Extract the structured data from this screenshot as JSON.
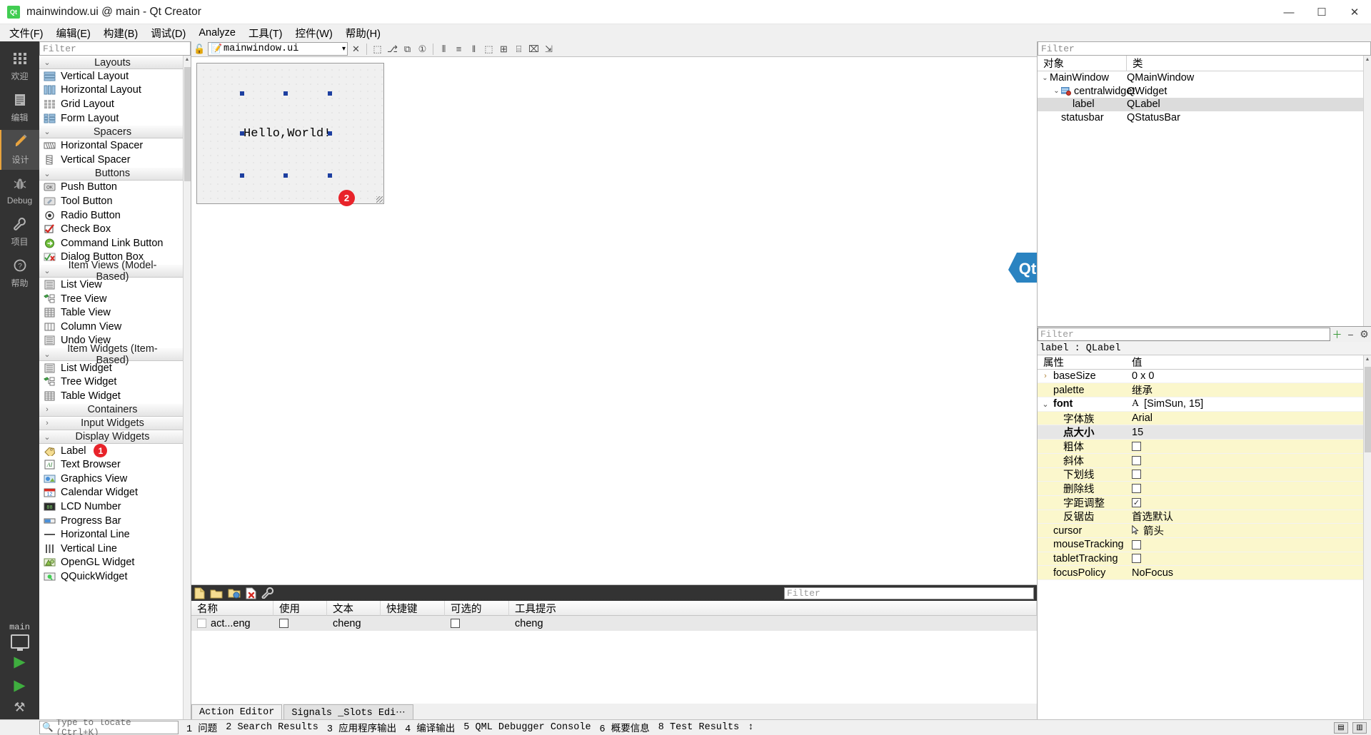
{
  "window": {
    "title": "mainwindow.ui @ main - Qt Creator",
    "logo_text": "Qt",
    "minimize": "—",
    "maximize": "☐",
    "close": "✕"
  },
  "menubar": [
    {
      "label": "文件(F)"
    },
    {
      "label": "编辑(E)"
    },
    {
      "label": "构建(B)"
    },
    {
      "label": "调试(D)"
    },
    {
      "label": "Analyze"
    },
    {
      "label": "工具(T)"
    },
    {
      "label": "控件(W)"
    },
    {
      "label": "帮助(H)"
    }
  ],
  "modebar": {
    "modes": [
      {
        "label": "欢迎",
        "icon": "grid-icon",
        "glyph": "∷",
        "active": false
      },
      {
        "label": "编辑",
        "icon": "document-icon",
        "glyph": "☰",
        "active": false
      },
      {
        "label": "设计",
        "icon": "pencil-icon",
        "glyph": "✎",
        "active": true
      },
      {
        "label": "Debug",
        "icon": "bug-icon",
        "glyph": "☣",
        "active": false
      },
      {
        "label": "项目",
        "icon": "wrench-icon",
        "glyph": "⚒",
        "active": false
      },
      {
        "label": "帮助",
        "icon": "help-icon",
        "glyph": "?",
        "active": false
      }
    ],
    "kit_name": "main",
    "run_glyph": "▶",
    "debug_glyph": "▶",
    "build_glyph": "⚒"
  },
  "widgetbox": {
    "filter_placeholder": "Filter",
    "groups": [
      {
        "title": "Layouts",
        "expanded": true,
        "arrow": "⌄",
        "items": [
          {
            "label": "Vertical Layout",
            "icon": "vertical-layout-icon"
          },
          {
            "label": "Horizontal Layout",
            "icon": "horizontal-layout-icon"
          },
          {
            "label": "Grid Layout",
            "icon": "grid-layout-icon"
          },
          {
            "label": "Form Layout",
            "icon": "form-layout-icon"
          }
        ]
      },
      {
        "title": "Spacers",
        "expanded": true,
        "arrow": "⌄",
        "items": [
          {
            "label": "Horizontal Spacer",
            "icon": "horizontal-spacer-icon"
          },
          {
            "label": "Vertical Spacer",
            "icon": "vertical-spacer-icon"
          }
        ]
      },
      {
        "title": "Buttons",
        "expanded": true,
        "arrow": "⌄",
        "items": [
          {
            "label": "Push Button",
            "icon": "push-button-icon"
          },
          {
            "label": "Tool Button",
            "icon": "tool-button-icon"
          },
          {
            "label": "Radio Button",
            "icon": "radio-button-icon"
          },
          {
            "label": "Check Box",
            "icon": "check-box-icon"
          },
          {
            "label": "Command Link Button",
            "icon": "command-link-button-icon"
          },
          {
            "label": "Dialog Button Box",
            "icon": "dialog-button-box-icon"
          }
        ]
      },
      {
        "title": "Item Views (Model-Based)",
        "expanded": true,
        "arrow": "⌄",
        "items": [
          {
            "label": "List View",
            "icon": "list-view-icon"
          },
          {
            "label": "Tree View",
            "icon": "tree-view-icon"
          },
          {
            "label": "Table View",
            "icon": "table-view-icon"
          },
          {
            "label": "Column View",
            "icon": "column-view-icon"
          },
          {
            "label": "Undo View",
            "icon": "undo-view-icon"
          }
        ]
      },
      {
        "title": "Item Widgets (Item-Based)",
        "expanded": true,
        "arrow": "⌄",
        "items": [
          {
            "label": "List Widget",
            "icon": "list-widget-icon"
          },
          {
            "label": "Tree Widget",
            "icon": "tree-widget-icon"
          },
          {
            "label": "Table Widget",
            "icon": "table-widget-icon"
          }
        ]
      },
      {
        "title": "Containers",
        "expanded": false,
        "arrow": "›",
        "items": []
      },
      {
        "title": "Input Widgets",
        "expanded": false,
        "arrow": "›",
        "items": []
      },
      {
        "title": "Display Widgets",
        "expanded": true,
        "arrow": "⌄",
        "items": [
          {
            "label": "Label",
            "icon": "label-icon",
            "badge": "1"
          },
          {
            "label": "Text Browser",
            "icon": "text-browser-icon"
          },
          {
            "label": "Graphics View",
            "icon": "graphics-view-icon"
          },
          {
            "label": "Calendar Widget",
            "icon": "calendar-widget-icon"
          },
          {
            "label": "LCD Number",
            "icon": "lcd-number-icon"
          },
          {
            "label": "Progress Bar",
            "icon": "progress-bar-icon"
          },
          {
            "label": "Horizontal Line",
            "icon": "horizontal-line-icon"
          },
          {
            "label": "Vertical Line",
            "icon": "vertical-line-icon"
          },
          {
            "label": "OpenGL Widget",
            "icon": "opengl-widget-icon"
          },
          {
            "label": "QQuickWidget",
            "icon": "qquickwidget-icon"
          }
        ]
      }
    ]
  },
  "editor_toolbar": {
    "file_name": "mainwindow.ui",
    "file_icon": "ui-file-icon",
    "lock_icon": "lock-icon",
    "dropdown_arrow": "▾",
    "close_label": "✕",
    "tools": [
      {
        "icon": "edit-widgets-icon",
        "glyph": "⬚"
      },
      {
        "icon": "edit-signals-slots-icon",
        "glyph": "⎇"
      },
      {
        "icon": "edit-buddies-icon",
        "glyph": "⧉"
      },
      {
        "icon": "edit-tab-order-icon",
        "glyph": "①"
      },
      {
        "icon": "layout-horizontally-icon",
        "glyph": "⦀"
      },
      {
        "icon": "layout-vertically-icon",
        "glyph": "≡"
      },
      {
        "icon": "layout-splitter-h-icon",
        "glyph": "‖"
      },
      {
        "icon": "layout-splitter-v-icon",
        "glyph": "⬚"
      },
      {
        "icon": "layout-grid-icon",
        "glyph": "⊞"
      },
      {
        "icon": "layout-form-icon",
        "glyph": "⌸"
      },
      {
        "icon": "break-layout-icon",
        "glyph": "⌧"
      },
      {
        "icon": "adjust-size-icon",
        "glyph": "⇲"
      }
    ]
  },
  "form": {
    "label_text": "Hello,World!",
    "badge": "2"
  },
  "object_tree": {
    "filter_placeholder": "Filter",
    "columns": [
      "对象",
      "类"
    ],
    "rows": [
      {
        "name": "MainWindow",
        "class": "QMainWindow",
        "depth": 0,
        "twisty": "⌄",
        "icon": null,
        "selected": false
      },
      {
        "name": "centralwidget",
        "class": "QWidget",
        "depth": 1,
        "twisty": "⌄",
        "icon": "widget-icon",
        "selected": false
      },
      {
        "name": "label",
        "class": "QLabel",
        "depth": 2,
        "twisty": "",
        "icon": null,
        "selected": true
      },
      {
        "name": "statusbar",
        "class": "QStatusBar",
        "depth": 1,
        "twisty": "",
        "icon": null,
        "selected": false
      }
    ]
  },
  "property_editor": {
    "filter_placeholder": "Filter",
    "add_glyph": "＋",
    "remove_glyph": "−",
    "config_glyph": "⚙",
    "object_line": "label : QLabel",
    "columns": [
      "属性",
      "值"
    ],
    "rows": [
      {
        "name": "baseSize",
        "value": "0 x 0",
        "expand": "›",
        "indent": 0,
        "style": "white",
        "type": "text"
      },
      {
        "name": "palette",
        "value": "继承",
        "expand": "",
        "indent": 0,
        "style": "yellow",
        "type": "text"
      },
      {
        "name": "font",
        "value": "[SimSun, 15]",
        "expand": "⌄",
        "indent": 0,
        "style": "white",
        "type": "font",
        "bold": true,
        "prefix_icon": "font-A-icon"
      },
      {
        "name": "字体族",
        "value": "Arial",
        "expand": "",
        "indent": 1,
        "style": "yellow",
        "type": "text"
      },
      {
        "name": "点大小",
        "value": "15",
        "expand": "",
        "indent": 1,
        "style": "grayhl",
        "type": "text",
        "bold": true
      },
      {
        "name": "粗体",
        "value": "",
        "expand": "",
        "indent": 1,
        "style": "yellow",
        "type": "checkbox",
        "checked": false
      },
      {
        "name": "斜体",
        "value": "",
        "expand": "",
        "indent": 1,
        "style": "yellow",
        "type": "checkbox",
        "checked": false
      },
      {
        "name": "下划线",
        "value": "",
        "expand": "",
        "indent": 1,
        "style": "yellow",
        "type": "checkbox",
        "checked": false
      },
      {
        "name": "删除线",
        "value": "",
        "expand": "",
        "indent": 1,
        "style": "yellow",
        "type": "checkbox",
        "checked": false
      },
      {
        "name": "字距调整",
        "value": "",
        "expand": "",
        "indent": 1,
        "style": "yellow",
        "type": "checkbox",
        "checked": true
      },
      {
        "name": "反锯齿",
        "value": "首选默认",
        "expand": "",
        "indent": 1,
        "style": "yellow",
        "type": "text"
      },
      {
        "name": "cursor",
        "value": "箭头",
        "expand": "",
        "indent": 0,
        "style": "yellow",
        "type": "cursor",
        "prefix_icon": "arrow-cursor-icon"
      },
      {
        "name": "mouseTracking",
        "value": "",
        "expand": "",
        "indent": 0,
        "style": "yellow",
        "type": "checkbox",
        "checked": false
      },
      {
        "name": "tabletTracking",
        "value": "",
        "expand": "",
        "indent": 0,
        "style": "yellow",
        "type": "checkbox",
        "checked": false
      },
      {
        "name": "focusPolicy",
        "value": "NoFocus",
        "expand": "",
        "indent": 0,
        "style": "yellow",
        "type": "text"
      }
    ]
  },
  "action_editor": {
    "filter_placeholder": "Filter",
    "toolbar": [
      {
        "icon": "new-action-icon"
      },
      {
        "icon": "open-folder-icon"
      },
      {
        "icon": "copy-icon"
      },
      {
        "icon": "delete-icon"
      },
      {
        "icon": "configure-icon"
      }
    ],
    "columns": [
      "名称",
      "使用",
      "文本",
      "快捷键",
      "可选的",
      "工具提示"
    ],
    "rows": [
      {
        "name": "act...eng",
        "used": false,
        "text": "cheng",
        "shortcut": "",
        "checkable": false,
        "tooltip": "cheng",
        "selected": true
      }
    ],
    "tabs": [
      {
        "label": "Action Editor",
        "active": true
      },
      {
        "label": "Signals _Slots Edi⋯",
        "active": false
      }
    ]
  },
  "statusbar": {
    "locator_placeholder": "Type to locate (Ctrl+K)",
    "search_icon": "magnifier-icon",
    "items": [
      {
        "num": "1",
        "label": "问题"
      },
      {
        "num": "2",
        "label": "Search Results"
      },
      {
        "num": "3",
        "label": "应用程序输出"
      },
      {
        "num": "4",
        "label": "编译输出"
      },
      {
        "num": "5",
        "label": "QML Debugger Console"
      },
      {
        "num": "6",
        "label": "概要信息"
      },
      {
        "num": "8",
        "label": "Test Results"
      }
    ],
    "more_glyph": "↕",
    "right_icons": [
      {
        "icon": "sidebar-toggle-icon",
        "glyph": "▤"
      },
      {
        "icon": "output-toggle-icon",
        "glyph": "▥"
      }
    ]
  },
  "colors": {
    "accent_red": "#e8232a",
    "qt_green": "#41cd52",
    "mode_active": "#4b4b4b",
    "property_yellow": "#fbf7cc",
    "handle_blue": "#1d3fa0"
  }
}
